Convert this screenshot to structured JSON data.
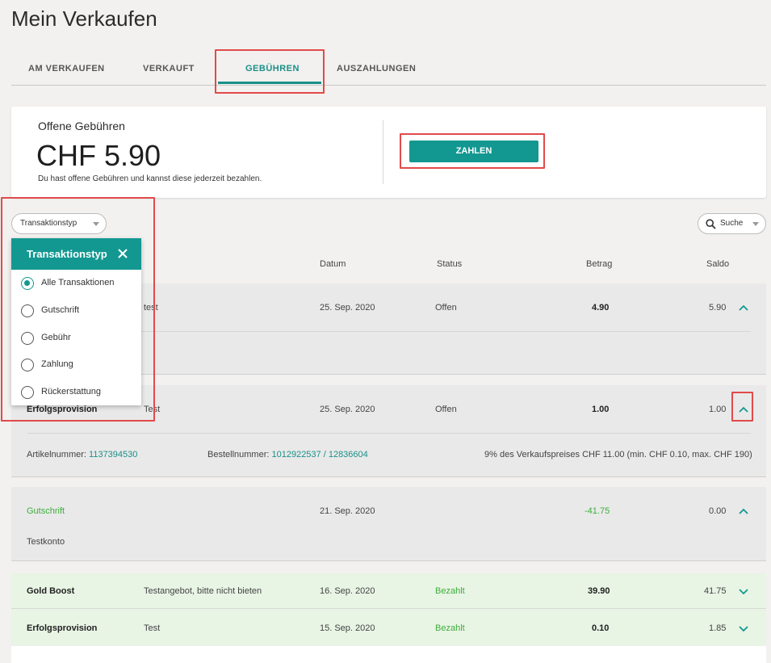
{
  "page": {
    "title": "Mein Verkaufen"
  },
  "tabs": [
    {
      "label": "AM VERKAUFEN",
      "active": false
    },
    {
      "label": "VERKAUFT",
      "active": false
    },
    {
      "label": "GEBÜHREN",
      "active": true
    },
    {
      "label": "AUSZAHLUNGEN",
      "active": false
    }
  ],
  "summary": {
    "heading": "Offene Gebühren",
    "amount": "CHF 5.90",
    "description": "Du hast offene Gebühren und kannst diese jederzeit bezahlen.",
    "pay_label": "ZAHLEN"
  },
  "filters": {
    "type_label": "Transaktionstyp",
    "search_label": "Suche"
  },
  "dropdown": {
    "title": "Transaktionstyp",
    "options": [
      {
        "label": "Alle Transaktionen",
        "selected": true
      },
      {
        "label": "Gutschrift",
        "selected": false
      },
      {
        "label": "Gebühr",
        "selected": false
      },
      {
        "label": "Zahlung",
        "selected": false
      },
      {
        "label": "Rückerstattung",
        "selected": false
      }
    ]
  },
  "table": {
    "columns": {
      "date": "Datum",
      "status": "Status",
      "amount": "Betrag",
      "balance": "Saldo"
    },
    "rows": [
      {
        "type": "",
        "description": "test",
        "date": "25. Sep. 2020",
        "status": "Offen",
        "amount": "4.90",
        "balance": "5.90",
        "expanded": true
      },
      {
        "type": "Erfolgsprovision",
        "description": "Test",
        "date": "25. Sep. 2020",
        "status": "Offen",
        "amount": "1.00",
        "balance": "1.00",
        "expanded": true,
        "details": {
          "article_label": "Artikelnummer:",
          "article_value": "1137394530",
          "order_label": "Bestellnummer:",
          "order_value": "1012922537 / 12836604",
          "note": "9% des Verkaufspreises CHF 11.00 (min. CHF 0.10, max. CHF 190)"
        }
      },
      {
        "type": "Gutschrift",
        "description": "",
        "date": "21. Sep. 2020",
        "status": "",
        "amount": "-41.75",
        "balance": "0.00",
        "expanded": true,
        "details": {
          "note": "Testkonto"
        }
      },
      {
        "type": "Gold Boost",
        "description": "Testangebot, bitte nicht bieten",
        "date": "16. Sep. 2020",
        "status": "Bezahlt",
        "amount": "39.90",
        "balance": "41.75",
        "expanded": false
      },
      {
        "type": "Erfolgsprovision",
        "description": "Test",
        "date": "15. Sep. 2020",
        "status": "Bezahlt",
        "amount": "0.10",
        "balance": "1.85",
        "expanded": false
      }
    ]
  },
  "colors": {
    "accent": "#139891",
    "positive": "#3cae3c",
    "highlight": "#e24a4a",
    "paid_row": "#e8f4e4"
  }
}
